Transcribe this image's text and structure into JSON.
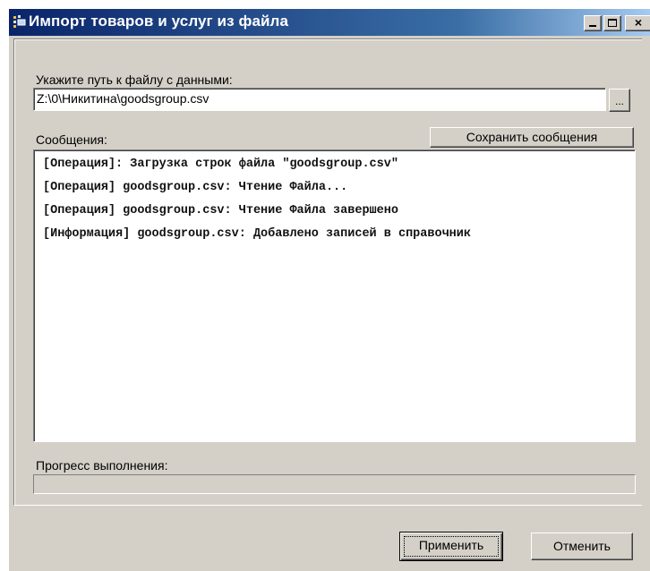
{
  "window": {
    "title": "Импорт товаров и услуг из файла",
    "controls": {
      "minimize": "minimize",
      "maximize": "maximize",
      "close": "×"
    }
  },
  "file": {
    "label": "Укажите путь к файлу с данными:",
    "path": "Z:\\0\\Никитина\\goodsgroup.csv",
    "browse_label": "..."
  },
  "messages": {
    "label": "Сообщения:",
    "save_label": "Сохранить сообщения",
    "lines": [
      "[Операция]: Загрузка строк файла \"goodsgroup.csv\"",
      "[Операция] goodsgroup.csv: Чтение Файла...",
      "[Операция] goodsgroup.csv: Чтение Файла завершено",
      "[Информация] goodsgroup.csv: Добавлено записей в справочник"
    ]
  },
  "progress": {
    "label": "Прогресс выполнения:",
    "value": 0
  },
  "buttons": {
    "apply": "Применить",
    "cancel": "Отменить"
  },
  "colors": {
    "titlebar_start": "#0a246a",
    "titlebar_end": "#a6caf0",
    "face": "#d4d0c8"
  }
}
